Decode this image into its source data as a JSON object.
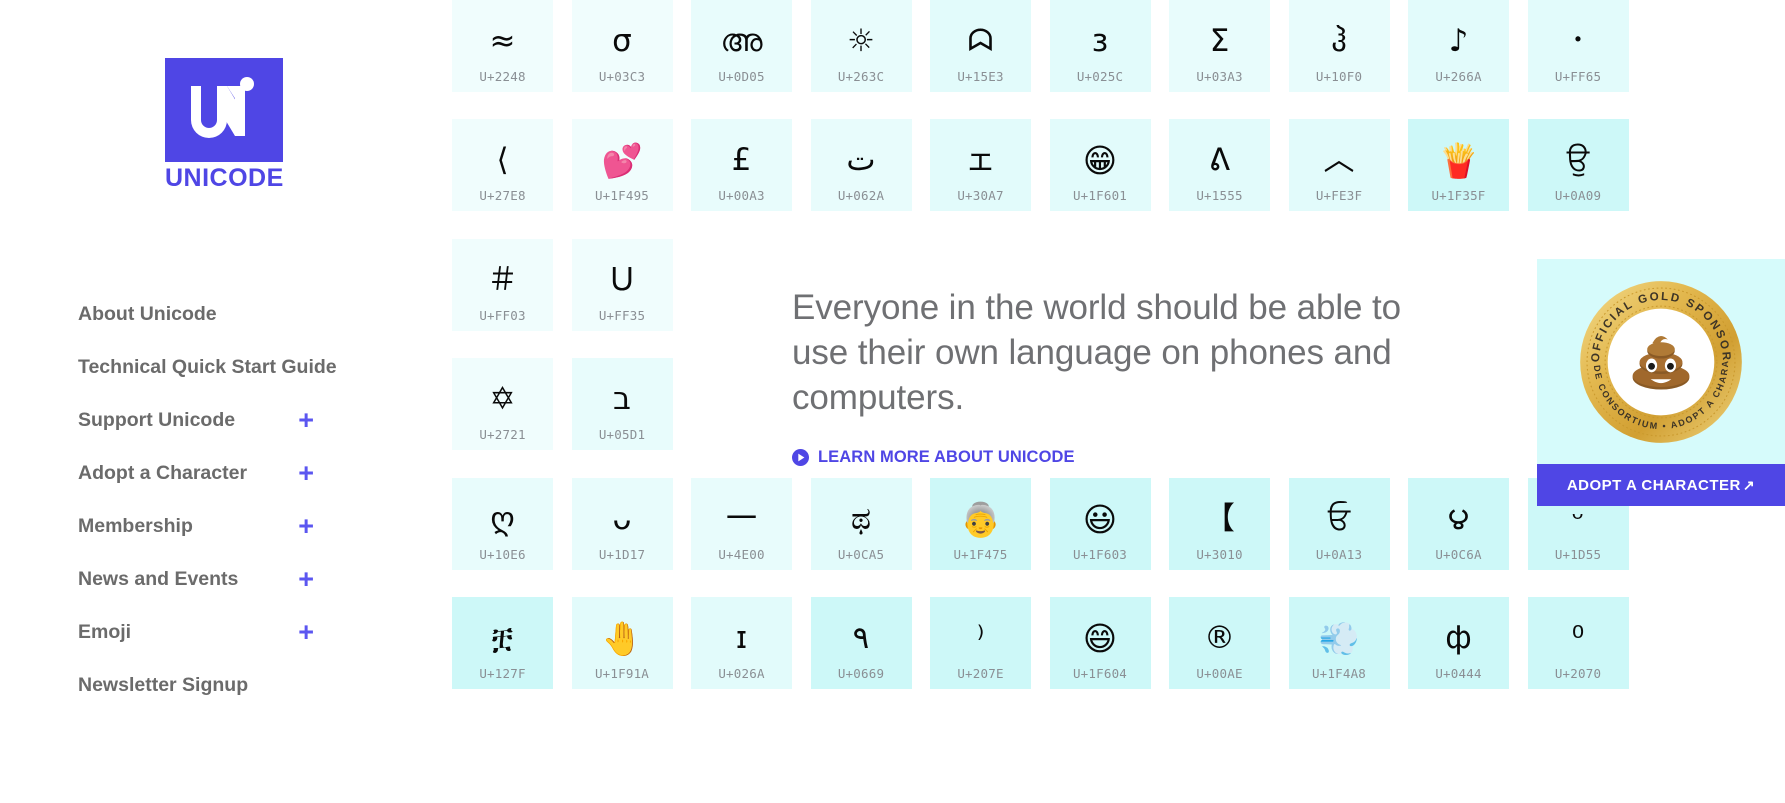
{
  "brand": {
    "logo_mark_text": "UNi",
    "logo_wordmark": "UNICODE",
    "logo_color": "#4f46e5"
  },
  "sidebar": {
    "items": [
      {
        "label": "About Unicode",
        "expandable": false,
        "external": false
      },
      {
        "label": "Technical Quick Start Guide",
        "expandable": false,
        "external": false
      },
      {
        "label": "Support Unicode",
        "expandable": true,
        "external": false,
        "plus": "+"
      },
      {
        "label": "Adopt a Character",
        "expandable": true,
        "external": false,
        "plus": "+"
      },
      {
        "label": "Membership",
        "expandable": true,
        "external": false,
        "plus": "+"
      },
      {
        "label": "News and Events",
        "expandable": true,
        "external": false,
        "plus": "+"
      },
      {
        "label": "Emoji",
        "expandable": true,
        "external": false,
        "plus": "+"
      },
      {
        "label": "Newsletter Signup",
        "expandable": false,
        "external": true,
        "arrow": "↗"
      }
    ]
  },
  "hero": {
    "headline": "Everyone in the world should be able to use their own language on phones and computers.",
    "cta_label": "LEARN MORE ABOUT UNICODE",
    "cta_icon": "play-circle-icon",
    "accent_color": "#4f46e5",
    "text_color": "#6f7073"
  },
  "sponsor": {
    "panel_bg": "#d6fbfb",
    "badge_top_text": "OFFICIAL GOLD SPONSOR",
    "badge_bottom_text": "UNICODE CONSORTIUM  •  ADOPT A CHARACTER",
    "badge_center_emoji": "💩",
    "badge_gold": "#d9a93a",
    "button_label": "ADOPT A CHARACTER",
    "button_arrow": "↗",
    "button_color": "#4f46e5"
  },
  "grid": {
    "tile_bg_light": "#f0fdfd",
    "tile_bg_mid": "#e2fbfb",
    "tile_bg_dark": "#cdf8f8",
    "code_color": "#8a8f94",
    "rows": [
      [
        {
          "char": "≈",
          "code": "U+2248",
          "shade": 0
        },
        {
          "char": "σ",
          "code": "U+03C3",
          "shade": 0
        },
        {
          "char": "അ",
          "code": "U+0D05",
          "shade": 1
        },
        {
          "char": "☼",
          "code": "U+263C",
          "shade": 1
        },
        {
          "char": "ᗣ",
          "code": "U+15E3",
          "shade": 2
        },
        {
          "char": "ɜ",
          "code": "U+025C",
          "shade": 2
        },
        {
          "char": "Σ",
          "code": "U+03A3",
          "shade": 1
        },
        {
          "char": "ჰ",
          "code": "U+10F0",
          "shade": 1
        },
        {
          "char": "♪",
          "code": "U+266A",
          "shade": 2
        },
        {
          "char": "･",
          "code": "U+FF65",
          "shade": 2
        }
      ],
      [
        {
          "char": "⟨",
          "code": "U+27E8",
          "shade": 0
        },
        {
          "char": "💕",
          "code": "U+1F495",
          "shade": 0,
          "emoji": true
        },
        {
          "char": "£",
          "code": "U+00A3",
          "shade": 1
        },
        {
          "char": "ت",
          "code": "U+062A",
          "shade": 1
        },
        {
          "char": "ェ",
          "code": "U+30A7",
          "shade": 2
        },
        {
          "char": "😁",
          "code": "U+1F601",
          "shade": 2,
          "emoji": true
        },
        {
          "char": "ᕕ",
          "code": "U+1555",
          "shade": 2
        },
        {
          "char": "︿",
          "code": "U+FE3F",
          "shade": 2
        },
        {
          "char": "🍟",
          "code": "U+1F35F",
          "shade": 3,
          "emoji": true
        },
        {
          "char": "ਉ",
          "code": "U+0A09",
          "shade": 3
        }
      ],
      [
        {
          "char": "＃",
          "code": "U+FF03",
          "shade": 0
        },
        {
          "char": "Ｕ",
          "code": "U+FF35",
          "shade": 0
        }
      ],
      [
        {
          "char": "✡",
          "code": "U+2721",
          "shade": 0
        },
        {
          "char": "ב",
          "code": "U+05D1",
          "shade": 1
        }
      ],
      [
        {
          "char": "ღ",
          "code": "U+10E6",
          "shade": 1
        },
        {
          "char": "ᴗ",
          "code": "U+1D17",
          "shade": 1
        },
        {
          "char": "一",
          "code": "U+4E00",
          "shade": 1
        },
        {
          "char": "ಥ",
          "code": "U+0CA5",
          "shade": 2
        },
        {
          "char": "👵",
          "code": "U+1F475",
          "shade": 3,
          "emoji": true
        },
        {
          "char": "😃",
          "code": "U+1F603",
          "shade": 3,
          "emoji": true
        },
        {
          "char": "【",
          "code": "U+3010",
          "shade": 3
        },
        {
          "char": "ਓ",
          "code": "U+0A13",
          "shade": 3
        },
        {
          "char": "౪",
          "code": "U+0C6A",
          "shade": 3
        },
        {
          "char": "ᵕ",
          "code": "U+1D55",
          "shade": 3
        }
      ],
      [
        {
          "char": "ቿ",
          "code": "U+127F",
          "shade": 3
        },
        {
          "char": "🤚",
          "code": "U+1F91A",
          "shade": 2,
          "emoji": true
        },
        {
          "char": "ɪ",
          "code": "U+026A",
          "shade": 2
        },
        {
          "char": "٩",
          "code": "U+0669",
          "shade": 3
        },
        {
          "char": "⁾",
          "code": "U+207E",
          "shade": 3
        },
        {
          "char": "😄",
          "code": "U+1F604",
          "shade": 3,
          "emoji": true
        },
        {
          "char": "®",
          "code": "U+00AE",
          "shade": 3
        },
        {
          "char": "💨",
          "code": "U+1F4A8",
          "shade": 3,
          "emoji": true
        },
        {
          "char": "ф",
          "code": "U+0444",
          "shade": 3
        },
        {
          "char": "⁰",
          "code": "U+2070",
          "shade": 3
        }
      ]
    ]
  }
}
